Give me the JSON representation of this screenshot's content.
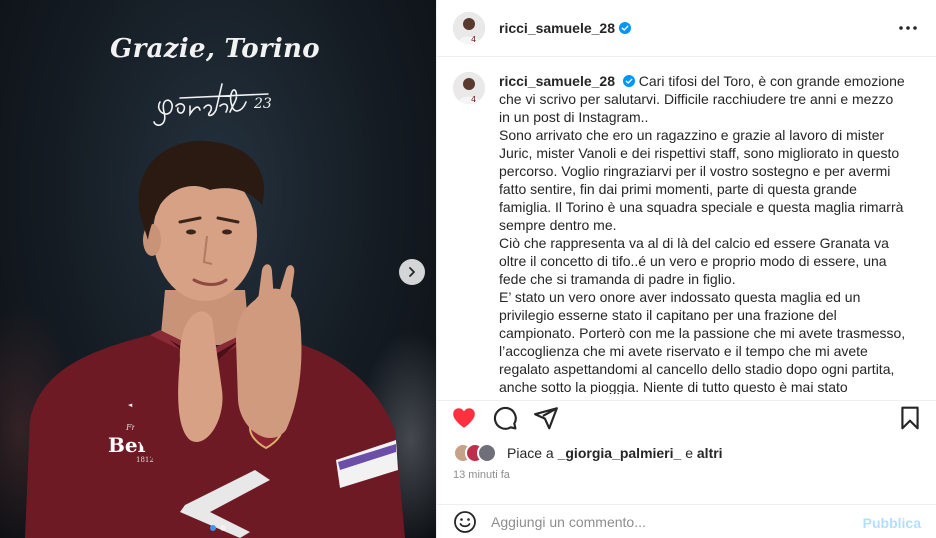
{
  "media": {
    "title": "Grazie, Torino",
    "signature_number": "23",
    "jersey_sponsor": "Beretta",
    "jersey_sponsor_small": "Fratelli",
    "jersey_year": "1812",
    "carousel_total": 2,
    "carousel_active": 1
  },
  "post": {
    "username": "ricci_samuele_28",
    "verified": true,
    "caption_paragraphs": [
      "Cari tifosi del Toro, è con grande emozione che vi scrivo per salutarvi. Difficile racchiudere tre anni e mezzo in un post di Instagram..",
      "Sono arrivato che ero un ragazzino e grazie al lavoro di mister Juric, mister Vanoli e dei rispettivi staff, sono migliorato in questo percorso. Voglio ringraziarvi per il vostro sostegno e per avermi fatto sentire, fin dai primi momenti, parte di questa grande famiglia. Il Torino è una squadra speciale e questa maglia rimarrà sempre dentro me.",
      "Ciò che rappresenta va al di là del calcio ed essere Granata va oltre il concetto di tifo..é un vero e proprio modo di essere, una fede che si tramanda di padre in figlio.",
      "E’ stato un vero onore aver indossato questa maglia ed un privilegio esserne stato il capitano per una frazione del campionato. Porterò con me la passione che mi avete trasmesso, l’accoglienza che mi avete riservato e il tempo che mi avete regalato aspettandomi al cancello dello stadio dopo ogni partita, anche sotto la pioggia. Niente di tutto questo è mai stato scontato."
    ]
  },
  "likes": {
    "prefix": "Piace a",
    "user": "_giorgia_palmieri_",
    "suffix": "e",
    "others": "altri"
  },
  "timestamp": "13 minuti fa",
  "comment": {
    "placeholder": "Aggiungi un commento...",
    "publish_label": "Pubblica"
  },
  "colors": {
    "like_red": "#ff3040",
    "verified_blue": "#0095f6",
    "publish_disabled": "#b2dffc",
    "jersey_maroon": "#7a1f2b"
  },
  "icons": {
    "like": "heart-filled-icon",
    "comment": "comment-bubble-icon",
    "share": "paper-plane-icon",
    "save": "bookmark-icon",
    "more": "more-horizontal-icon",
    "emoji": "smiley-icon",
    "next": "chevron-right-icon"
  }
}
